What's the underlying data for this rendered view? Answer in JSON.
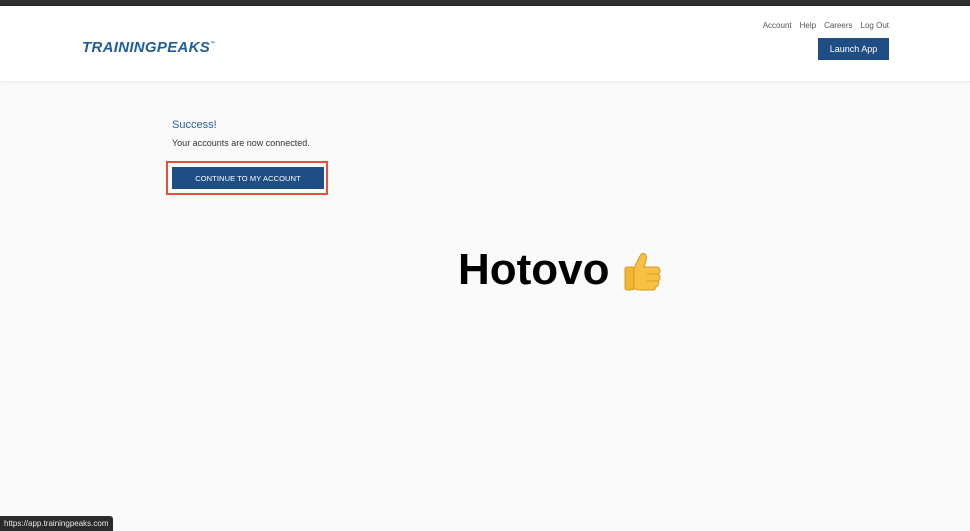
{
  "header": {
    "logo_text": "TRAININGPEAKS",
    "logo_tm": "™",
    "nav": {
      "account": "Account",
      "help": "Help",
      "careers": "Careers",
      "logout": "Log Out"
    },
    "launch_app_label": "Launch App"
  },
  "main": {
    "success_title": "Success!",
    "success_message": "Your accounts are now connected.",
    "continue_button_label": "CONTINUE TO MY ACCOUNT"
  },
  "overlay": {
    "done_text": "Hotovo",
    "done_icon": "thumbs-up-icon"
  },
  "status_bar": {
    "url": "https://app.trainingpeaks.com"
  },
  "colors": {
    "brand_blue": "#1f4e85",
    "logo_blue": "#1f5d9c",
    "success_blue": "#2a62a3",
    "highlight_red": "#e0523a"
  }
}
